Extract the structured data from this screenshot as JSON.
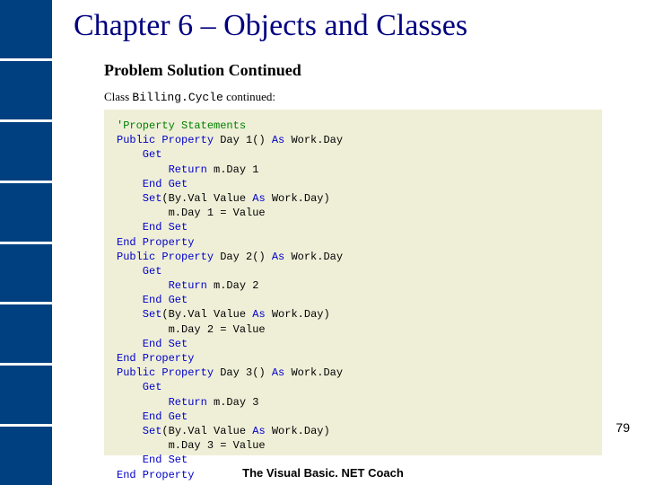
{
  "title": "Chapter 6 – Objects and Classes",
  "subtitle": "Problem Solution Continued",
  "classline_prefix": "Class ",
  "classline_code": "Billing.Cycle",
  "classline_suffix": " continued:",
  "footer": "The Visual Basic. NET Coach",
  "page_number": "79",
  "code": {
    "comment": "'Property Statements",
    "l01a": "Public",
    "l01b": " Property",
    "l01c": " Day 1() ",
    "l01d": "As",
    "l01e": " Work.Day",
    "l02a": "    Get",
    "l03a": "        Return",
    "l03b": " m.Day 1",
    "l04a": "    End Get",
    "l05a": "    Set",
    "l05b": "(By.Val Value ",
    "l05c": "As",
    "l05d": " Work.Day)",
    "l06a": "        m.Day 1 = Value",
    "l07a": "    End Set",
    "l08a": "End Property",
    "l09a": "Public",
    "l09b": " Property",
    "l09c": " Day 2() ",
    "l09d": "As",
    "l09e": " Work.Day",
    "l10a": "    Get",
    "l11a": "        Return",
    "l11b": " m.Day 2",
    "l12a": "    End Get",
    "l13a": "    Set",
    "l13b": "(By.Val Value ",
    "l13c": "As",
    "l13d": " Work.Day)",
    "l14a": "        m.Day 2 = Value",
    "l15a": "    End Set",
    "l16a": "End Property",
    "l17a": "Public",
    "l17b": " Property",
    "l17c": " Day 3() ",
    "l17d": "As",
    "l17e": " Work.Day",
    "l18a": "    Get",
    "l19a": "        Return",
    "l19b": " m.Day 3",
    "l20a": "    End Get",
    "l21a": "    Set",
    "l21b": "(By.Val Value ",
    "l21c": "As",
    "l21d": " Work.Day)",
    "l22a": "        m.Day 3 = Value",
    "l23a": "    End Set",
    "l24a": "End Property"
  }
}
